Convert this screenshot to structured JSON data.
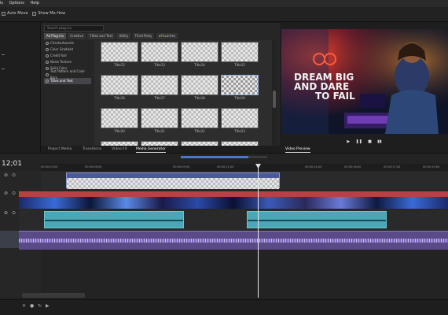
{
  "menu": {
    "items": [
      "ls",
      "Options",
      "Help"
    ]
  },
  "toolbar": {
    "auto_move": "Auto Move",
    "show_me_how": "Show Me How"
  },
  "media_generator": {
    "search_placeholder": "Search plug-ins",
    "tabs": [
      "All Plug-ins",
      "Creative",
      "Titles and Text",
      "Utility",
      "Third Party",
      "Favorites"
    ],
    "categories": [
      "Checkerboards",
      "Color Gradient",
      "Credit Roll",
      "Noise Texture",
      "Solid Color",
      "Test Pattern and Color Bars",
      "Titles and Text"
    ],
    "selected_category": 6,
    "thumbnails": [
      "Title12",
      "Title13",
      "Title14",
      "Title15",
      "Title16",
      "Title17",
      "Title18",
      "Title19",
      "Title20",
      "Title21",
      "Title22",
      "Title23"
    ],
    "selected_thumbnail": 7
  },
  "bottom_tabs": [
    "Project Media",
    "Transitions",
    "Video FX",
    "Media Generator"
  ],
  "active_bottom_tab": "Media Generator",
  "preview": {
    "tab": "Video Preview",
    "overlay_text": [
      "DREAM BIG",
      "AND DARE",
      "TO FAIL"
    ],
    "transport": [
      "▶",
      "❚❚",
      "■",
      "▮▮"
    ]
  },
  "timeline": {
    "timecode": "12;01",
    "ruler": [
      "00:00:03;00",
      "00:00:06;00",
      "00:00:09;00",
      "00:00:12;00",
      "00:00:14;00",
      "00:00:16;00",
      "00:00:17;00",
      "00:00:19;00"
    ],
    "tracks": [
      {
        "name": "title-track",
        "color": "#5a6fb0"
      },
      {
        "name": "video-track",
        "color": "#c0464d"
      },
      {
        "name": "audio-track-1",
        "color": "#3fa3b0"
      },
      {
        "name": "audio-track-2",
        "color": "#7b5ca8"
      }
    ]
  },
  "colors": {
    "accent": "#5a6fb0",
    "video": "#c0464d",
    "audio": "#3fa3b0",
    "music": "#7b5ca8"
  }
}
